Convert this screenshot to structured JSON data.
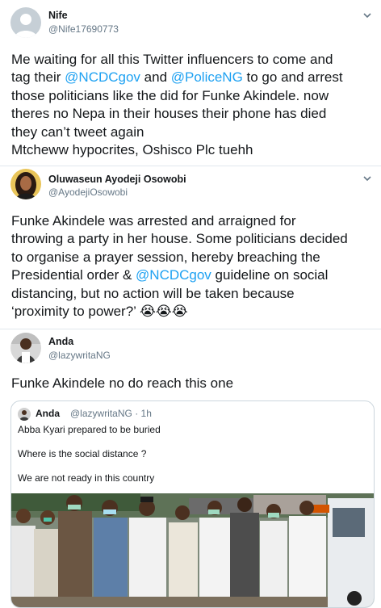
{
  "tweets": [
    {
      "name": "Nife",
      "handle": "@Nife17690773",
      "lines": [
        [
          {
            "t": "Me waiting for all this Twitter influencers to come and"
          }
        ],
        [
          {
            "t": "tag their "
          },
          {
            "t": "@NCDCgov",
            "m": true
          },
          {
            "t": " and "
          },
          {
            "t": "@PoliceNG",
            "m": true
          },
          {
            "t": " to go and arrest"
          }
        ],
        [
          {
            "t": "those politicians like the did for Funke Akindele. now"
          }
        ],
        [
          {
            "t": "theres no Nepa in their houses their phone has died"
          }
        ],
        [
          {
            "t": "they can’t tweet again"
          }
        ],
        [
          {
            "t": "Mtcheww hypocrites, Oshisco Plc tuehh"
          }
        ]
      ]
    },
    {
      "name": "Oluwaseun Ayodeji Osowobi",
      "handle": "@AyodejiOsowobi",
      "lines": [
        [
          {
            "t": "Funke Akindele was arrested and arraigned for"
          }
        ],
        [
          {
            "t": "throwing a party in her house. Some politicians decided"
          }
        ],
        [
          {
            "t": "to organise a prayer session, hereby breaching the"
          }
        ],
        [
          {
            "t": "Presidential order & "
          },
          {
            "t": "@NCDCgov",
            "m": true
          },
          {
            "t": " guideline on social"
          }
        ],
        [
          {
            "t": "distancing, but no action will be taken because"
          }
        ],
        [
          {
            "t": "‘proximity to power?’ 😭😭😭"
          }
        ]
      ]
    },
    {
      "name": "Anda",
      "handle": "@lazywritaNG",
      "lines": [
        [
          {
            "t": "Funke Akindele no do reach this one"
          }
        ]
      ]
    }
  ],
  "quoted": {
    "name": "Anda",
    "handle": "@lazywritaNG · 1h",
    "lines": [
      "Abba Kyari prepared to be buried",
      "Where is the social distance ?",
      "We are not ready in this country"
    ]
  },
  "colors": {
    "mention": "#1da1f2",
    "secondary": "#657786",
    "border": "#ccd6dd"
  },
  "icons": {
    "menu": "chevron-down-icon"
  }
}
